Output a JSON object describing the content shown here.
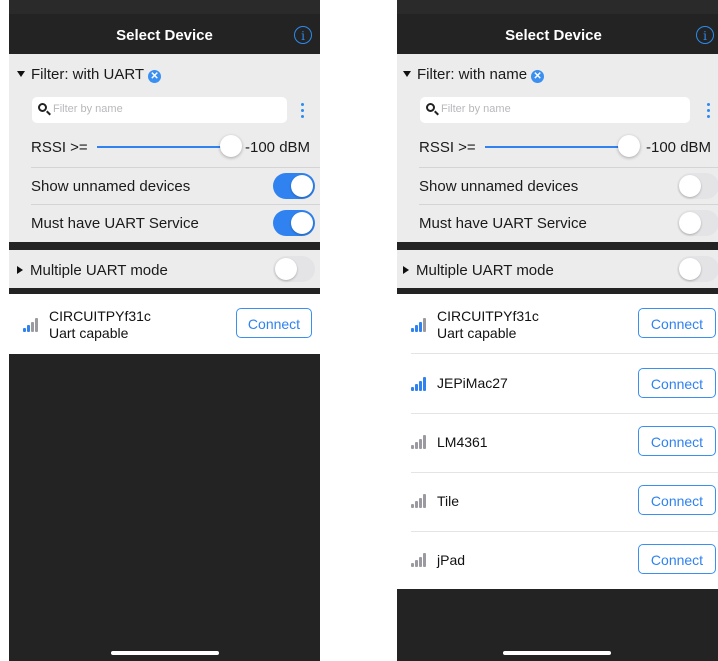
{
  "screens": [
    {
      "title": "Select Device",
      "filter_label": "Filter: with UART",
      "search_placeholder": "Filter by name",
      "rssi_label": "RSSI >=",
      "rssi_value": "-100 dBM",
      "rssi_fraction": 1.0,
      "show_unnamed_label": "Show unnamed devices",
      "show_unnamed_on": true,
      "must_uart_label": "Must have UART Service",
      "must_uart_on": true,
      "multi_uart_label": "Multiple UART mode",
      "multi_uart_on": false,
      "devices": [
        {
          "name": "CIRCUITPYf31c",
          "sub": "Uart capable",
          "signal_bars": 2,
          "button": "Connect"
        }
      ]
    },
    {
      "title": "Select Device",
      "filter_label": "Filter: with name",
      "search_placeholder": "Filter by name",
      "rssi_label": "RSSI >=",
      "rssi_value": "-100 dBM",
      "rssi_fraction": 1.0,
      "show_unnamed_label": "Show unnamed devices",
      "show_unnamed_on": false,
      "must_uart_label": "Must have UART Service",
      "must_uart_on": false,
      "multi_uart_label": "Multiple UART mode",
      "multi_uart_on": false,
      "devices": [
        {
          "name": "CIRCUITPYf31c",
          "sub": "Uart capable",
          "signal_bars": 3,
          "button": "Connect"
        },
        {
          "name": "JEPiMac27",
          "sub": "",
          "signal_bars": 4,
          "button": "Connect"
        },
        {
          "name": "LM4361",
          "sub": "",
          "signal_bars": 0,
          "button": "Connect"
        },
        {
          "name": "Tile",
          "sub": "",
          "signal_bars": 0,
          "button": "Connect"
        },
        {
          "name": "jPad",
          "sub": "",
          "signal_bars": 0,
          "button": "Connect"
        }
      ]
    }
  ],
  "colors": {
    "accent": "#2f82ef",
    "bar_active": "#2f82ef",
    "bar_inactive": "#9a9aa0",
    "panel_bg": "#ececed",
    "dark_bg": "#232323"
  },
  "icons": {
    "info": "info-circle-icon",
    "clear": "clear-x-icon",
    "search": "search-icon",
    "more": "more-vertical-icon",
    "signal": "signal-bars-icon",
    "expand": "triangle-down-icon",
    "collapse": "triangle-right-icon"
  }
}
